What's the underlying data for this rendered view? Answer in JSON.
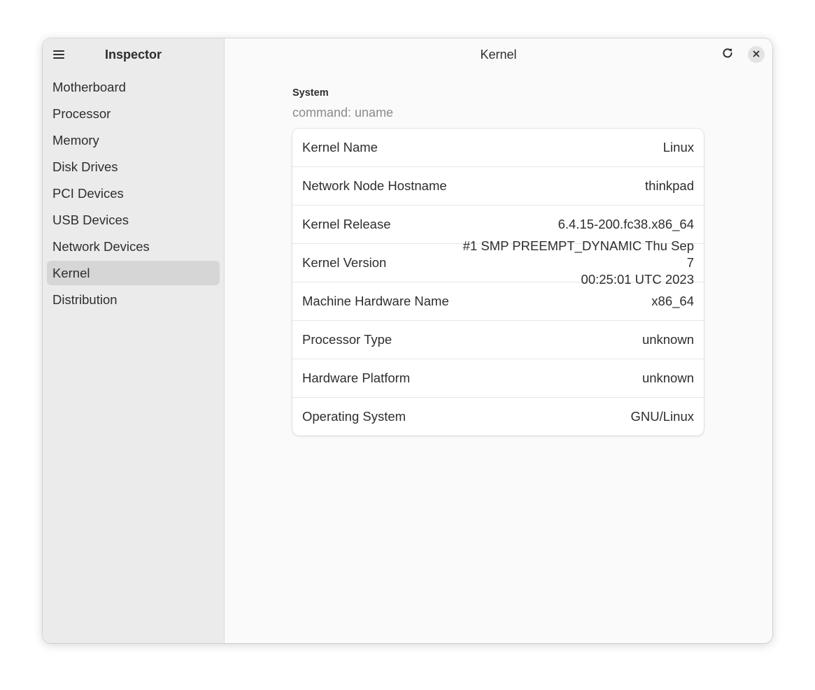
{
  "sidebar": {
    "title": "Inspector",
    "menu_icon": "hamburger-menu-icon",
    "items": [
      {
        "label": "Motherboard",
        "selected": false
      },
      {
        "label": "Processor",
        "selected": false
      },
      {
        "label": "Memory",
        "selected": false
      },
      {
        "label": "Disk Drives",
        "selected": false
      },
      {
        "label": "PCI Devices",
        "selected": false
      },
      {
        "label": "USB Devices",
        "selected": false
      },
      {
        "label": "Network Devices",
        "selected": false
      },
      {
        "label": "Kernel",
        "selected": true
      },
      {
        "label": "Distribution",
        "selected": false
      }
    ]
  },
  "header": {
    "title": "Kernel",
    "refresh_icon": "refresh-icon",
    "close_icon": "close-icon"
  },
  "section": {
    "title": "System",
    "subtitle": "command: uname",
    "rows": [
      {
        "label": "Kernel Name",
        "value": "Linux"
      },
      {
        "label": "Network Node Hostname",
        "value": "thinkpad"
      },
      {
        "label": "Kernel Release",
        "value": "6.4.15-200.fc38.x86_64"
      },
      {
        "label": "Kernel Version",
        "value": "#1 SMP PREEMPT_DYNAMIC Thu Sep  7\n00:25:01 UTC 2023"
      },
      {
        "label": "Machine Hardware Name",
        "value": "x86_64"
      },
      {
        "label": "Processor Type",
        "value": "unknown"
      },
      {
        "label": "Hardware Platform",
        "value": "unknown"
      },
      {
        "label": "Operating System",
        "value": "GNU/Linux"
      }
    ]
  },
  "colors": {
    "sidebar_bg": "#ebebeb",
    "selected_item_bg": "#d6d6d6",
    "content_bg": "#fafafa",
    "card_bg": "#ffffff",
    "text": "#2e2e2e",
    "dim_text": "#8a8a8a"
  }
}
